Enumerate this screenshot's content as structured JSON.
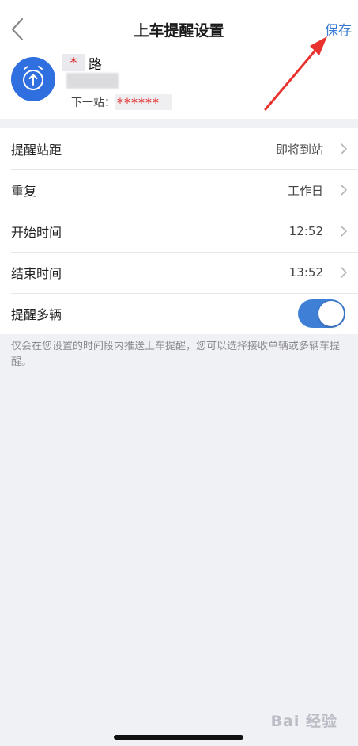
{
  "nav": {
    "title": "上车提醒设置",
    "save_label": "保存"
  },
  "route": {
    "name_mask": "*",
    "name_suffix": "路",
    "next_stop_label": "下一站：",
    "next_stop_value": "******"
  },
  "settings": [
    {
      "label": "提醒站距",
      "value": "即将到站"
    },
    {
      "label": "重复",
      "value": "工作日"
    },
    {
      "label": "开始时间",
      "value": "12:52"
    },
    {
      "label": "结束时间",
      "value": "13:52"
    },
    {
      "label": "提醒多辆",
      "toggle_on": true
    }
  ],
  "hint": "仅会在您设置的时间段内推送上车提醒，您可以选择接收单辆或多辆车提醒。",
  "watermark": "Bai 经验",
  "colors": {
    "accent": "#3a7bd5",
    "avatar_bg": "#2f6fe0",
    "toggle_on": "#3f7fd6",
    "annotation_arrow": "#e8322e",
    "mask_text": "#e02020"
  },
  "icons": {
    "back": "chevron-left-icon",
    "avatar": "alarm-clock-icon",
    "row_chevron": "chevron-right-icon"
  }
}
